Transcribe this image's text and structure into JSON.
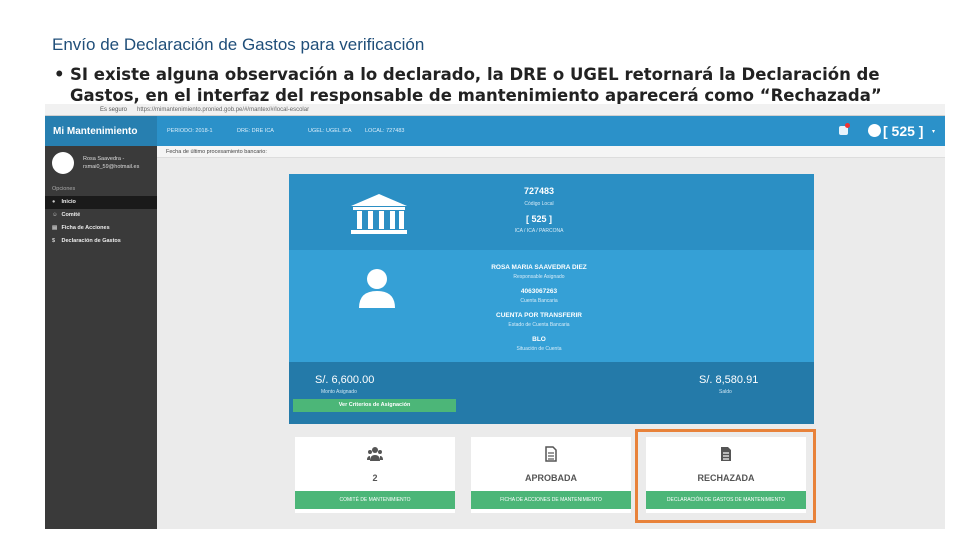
{
  "slide": {
    "title": "Envío de Declaración de Gastos para verificación",
    "bullet_marker": "•",
    "bullet_text": "SI existe alguna observación a lo declarado, la DRE o UGEL retornará la Declaración de Gastos, en el interfaz del responsable de mantenimiento aparecerá como  “Rechazada”"
  },
  "browser": {
    "secure_label": "Es seguro",
    "url": "https://mimantenimiento.pronied.gob.pe/#/mantex/#/local-escolar"
  },
  "topnav": {
    "brand": "Mi Mantenimiento",
    "periodo": "PERIODO: 2018-1",
    "dre": "DRE: DRE ICA",
    "ugel": "UGEL: UGEL ICA",
    "local": "LOCAL: 727483",
    "code_button": "[ 525 ]",
    "caret": "▾",
    "accent_color": "#2b91c9"
  },
  "sidebar": {
    "profile_name": "Rosa Saavedra -",
    "profile_email": "rsmai0_59@hotmail.es",
    "options_label": "Opciones",
    "items": [
      {
        "label": "Inicio",
        "icon": "●"
      },
      {
        "label": "Comité",
        "icon": "☺"
      },
      {
        "label": "Ficha de Acciones",
        "icon": "▤"
      },
      {
        "label": "Declaración de Gastos",
        "icon": "$"
      }
    ]
  },
  "subheader": {
    "text": "Fecha de último procesamiento bancario:"
  },
  "card": {
    "code": "727483",
    "code_label": "Código Local",
    "bracket_code": "[ 525 ]",
    "location": "ICA / ICA / PARCONA",
    "responsible_name": "ROSA MARIA SAAVEDRA DIEZ",
    "responsible_label": "Responsable Asignado",
    "account_number": "4063067263",
    "account_label": "Cuenta Bancaria",
    "account_type": "CUENTA POR TRANSFERIR",
    "account_type_label": "Estado de Cuenta Bancaria",
    "account_status": "BLO",
    "account_status_label": "Situación de Cuenta",
    "assigned_amount": "S/. 6,600.00",
    "assigned_label": "Monto Asignado",
    "balance_amount": "S/. 8,580.91",
    "balance_label": "Saldo",
    "criteria_button": "Ver Criterios de Asignación"
  },
  "tiles": [
    {
      "value": "2",
      "button": "COMITÉ DE MANTENIMIENTO",
      "icon": "users-icon"
    },
    {
      "value": "APROBADA",
      "button": "FICHA DE ACCIONES DE MANTENIMIENTO",
      "icon": "document-icon"
    },
    {
      "value": "RECHAZADA",
      "button": "DECLARACIÓN DE GASTOS DE MANTENIMIENTO",
      "icon": "document-icon"
    }
  ]
}
